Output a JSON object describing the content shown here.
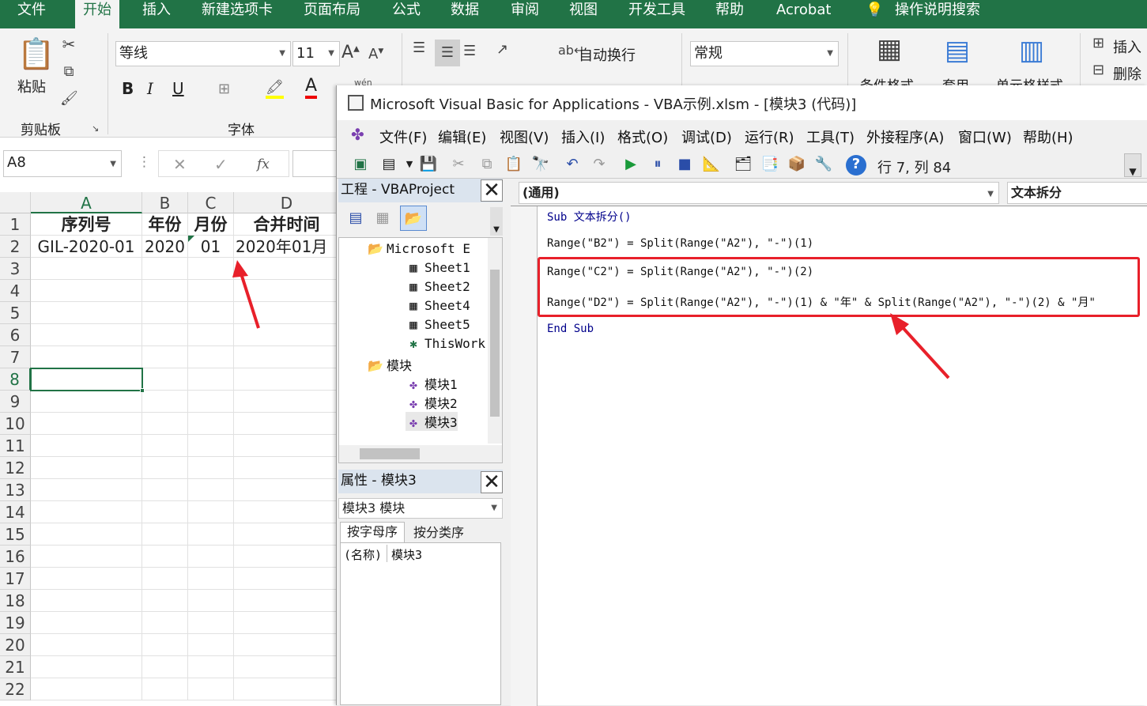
{
  "ribbon_tabs": [
    "文件",
    "开始",
    "插入",
    "新建选项卡",
    "页面布局",
    "公式",
    "数据",
    "审阅",
    "视图",
    "开发工具",
    "帮助",
    "Acrobat",
    "操作说明搜索"
  ],
  "ribbon": {
    "paste_label": "粘贴",
    "clipboard_label": "剪贴板",
    "font_name": "等线",
    "font_size": "11",
    "font_group_label": "字体",
    "wrap_text_label": "自动换行",
    "number_format": "常规",
    "cond_format_label": "条件格式",
    "table_format_label": "套用",
    "cell_style_label": "单元格样式",
    "insert_label": "插入",
    "delete_label": "删除",
    "bold": "B",
    "italic": "I",
    "underline": "U",
    "phonetic": "wén"
  },
  "formula_bar": {
    "name_box": "A8",
    "cancel": "✕",
    "enter": "✓",
    "fx": "fx"
  },
  "sheet": {
    "columns": [
      "A",
      "B",
      "C",
      "D"
    ],
    "rows": [
      "1",
      "2",
      "3",
      "4",
      "5",
      "6",
      "7",
      "8",
      "9",
      "10",
      "11",
      "12",
      "13",
      "14",
      "15",
      "16",
      "17",
      "18",
      "19",
      "20",
      "21",
      "22"
    ],
    "row1": [
      "序列号",
      "年份",
      "月份",
      "合并时间"
    ],
    "row2": [
      "GIL-2020-01",
      "2020",
      "01",
      "2020年01月"
    ]
  },
  "vba": {
    "title": "Microsoft Visual Basic for Applications - VBA示例.xlsm - [模块3 (代码)]",
    "menu": [
      "文件(F)",
      "编辑(E)",
      "视图(V)",
      "插入(I)",
      "格式(O)",
      "调试(D)",
      "运行(R)",
      "工具(T)",
      "外接程序(A)",
      "窗口(W)",
      "帮助(H)"
    ],
    "status": "行 7, 列 84",
    "project_title": "工程 - VBAProject",
    "tree": [
      "Microsoft E",
      "Sheet1",
      "Sheet2",
      "Sheet4",
      "Sheet5",
      "ThisWork",
      "模块",
      "模块1",
      "模块2",
      "模块3"
    ],
    "props_title": "属性 - 模块3",
    "props_object": "模块3 模块",
    "props_tabs": [
      "按字母序",
      "按分类序"
    ],
    "props_name_key": "(名称)",
    "props_name_val": "模块3",
    "combo_left": "(通用)",
    "combo_right": "文本拆分",
    "code": [
      "Sub 文本拆分()",
      "Range(\"B2\") = Split(Range(\"A2\"), \"-\")(1)",
      "Range(\"C2\") = Split(Range(\"A2\"), \"-\")(2)",
      "Range(\"D2\") = Split(Range(\"A2\"), \"-\")(1) & \"年\" & Split(Range(\"A2\"), \"-\")(2) & \"月\"",
      "End Sub"
    ]
  },
  "colors": {
    "excel_green": "#217346",
    "highlight_red": "#e8202a",
    "selected_green": "#217346"
  }
}
